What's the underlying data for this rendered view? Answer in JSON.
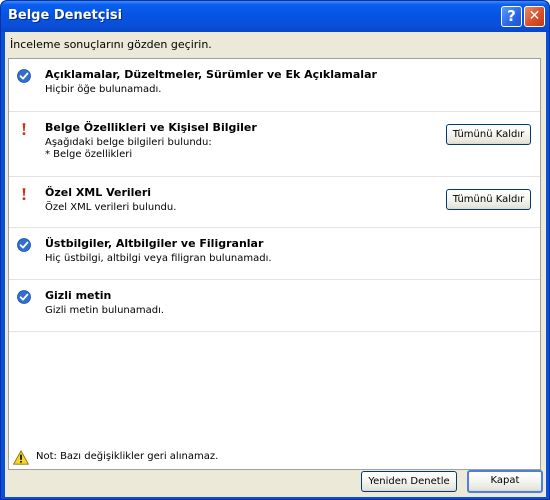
{
  "window": {
    "title": "Belge Denetçisi"
  },
  "intro": "İnceleme sonuçlarını gözden geçirin.",
  "sections": [
    {
      "status": "ok",
      "icon": "check-circle-icon",
      "heading": "Açıklamalar, Düzeltmeler, Sürümler ve Ek Açıklamalar",
      "details": "Hiçbir öğe bulunamadı."
    },
    {
      "status": "found",
      "icon": "exclamation-icon",
      "heading": "Belge Özellikleri ve Kişisel Bilgiler",
      "details": "Aşağıdaki belge bilgileri bulundu:\n* Belge özellikleri",
      "button": "Tümünü Kaldır"
    },
    {
      "status": "found",
      "icon": "exclamation-icon",
      "heading": "Özel XML Verileri",
      "details": "Özel XML verileri bulundu.",
      "button": "Tümünü Kaldır"
    },
    {
      "status": "ok",
      "icon": "check-circle-icon",
      "heading": "Üstbilgiler, Altbilgiler ve Filigranlar",
      "details": "Hiç üstbilgi, altbilgi veya filigran bulunamadı."
    },
    {
      "status": "ok",
      "icon": "check-circle-icon",
      "heading": "Gizli metin",
      "details": "Gizli metin bulunamadı."
    }
  ],
  "footer": {
    "note": "Not: Bazı değişiklikler geri alınamaz.",
    "reinspect_button": "Yeniden Denetle",
    "close_button": "Kapat"
  },
  "colors": {
    "titlebar": "#0a4fd8",
    "ok_icon": "#2f6fd0",
    "warn_icon": "#d42a12"
  }
}
